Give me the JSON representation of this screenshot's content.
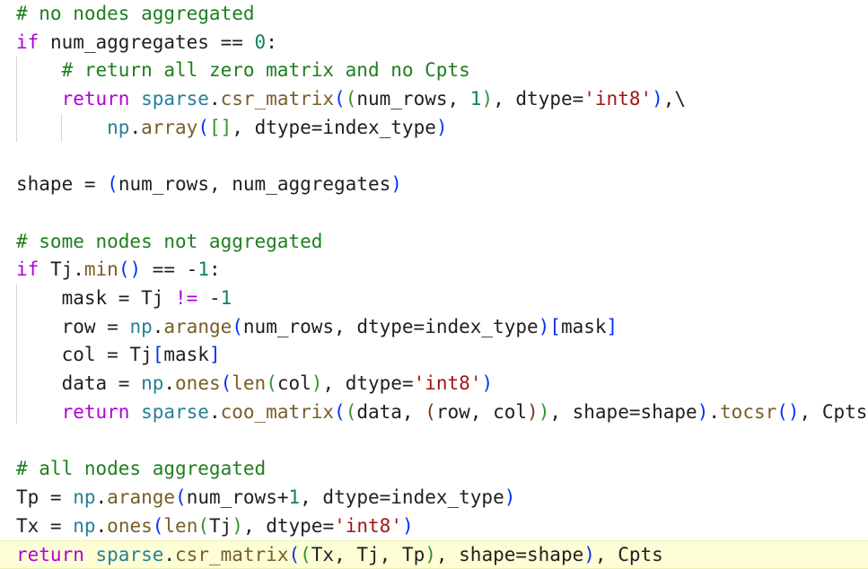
{
  "editor": {
    "lines": [
      {
        "tokens": [
          [
            "cm",
            "# no nodes aggregated"
          ]
        ]
      },
      {
        "tokens": [
          [
            "kw",
            "if"
          ],
          [
            "var",
            " num_aggregates "
          ],
          [
            "var",
            "=="
          ],
          [
            "var",
            " "
          ],
          [
            "num",
            "0"
          ],
          [
            "var",
            ":"
          ]
        ]
      },
      {
        "tokens": [
          [
            "var",
            "    "
          ],
          [
            "cm",
            "# return all zero matrix and no Cpts"
          ]
        ]
      },
      {
        "tokens": [
          [
            "var",
            "    "
          ],
          [
            "kw",
            "return"
          ],
          [
            "var",
            " "
          ],
          [
            "mod",
            "sparse"
          ],
          [
            "var",
            "."
          ],
          [
            "fn",
            "csr_matrix"
          ],
          [
            "bracket1",
            "("
          ],
          [
            "bracket2",
            "("
          ],
          [
            "var",
            "num_rows, "
          ],
          [
            "num",
            "1"
          ],
          [
            "bracket2",
            ")"
          ],
          [
            "var",
            ", dtype="
          ],
          [
            "str",
            "'int8'"
          ],
          [
            "bracket1",
            ")"
          ],
          [
            "var",
            ",\\"
          ]
        ]
      },
      {
        "tokens": [
          [
            "var",
            "        "
          ],
          [
            "mod",
            "np"
          ],
          [
            "var",
            "."
          ],
          [
            "fn",
            "array"
          ],
          [
            "bracket1",
            "("
          ],
          [
            "bracket2",
            "[]"
          ],
          [
            "var",
            ", dtype=index_type"
          ],
          [
            "bracket1",
            ")"
          ]
        ]
      },
      {
        "tokens": []
      },
      {
        "tokens": [
          [
            "var",
            "shape = "
          ],
          [
            "bracket1",
            "("
          ],
          [
            "var",
            "num_rows, num_aggregates"
          ],
          [
            "bracket1",
            ")"
          ]
        ]
      },
      {
        "tokens": []
      },
      {
        "tokens": [
          [
            "cm",
            "# some nodes not aggregated"
          ]
        ]
      },
      {
        "tokens": [
          [
            "kw",
            "if"
          ],
          [
            "var",
            " Tj."
          ],
          [
            "fn",
            "min"
          ],
          [
            "bracket1",
            "()"
          ],
          [
            "var",
            " == -"
          ],
          [
            "num",
            "1"
          ],
          [
            "var",
            ":"
          ]
        ]
      },
      {
        "tokens": [
          [
            "var",
            "    mask = Tj "
          ],
          [
            "kw",
            "!="
          ],
          [
            "var",
            " -"
          ],
          [
            "num",
            "1"
          ]
        ]
      },
      {
        "tokens": [
          [
            "var",
            "    row = "
          ],
          [
            "mod",
            "np"
          ],
          [
            "var",
            "."
          ],
          [
            "fn",
            "arange"
          ],
          [
            "bracket1",
            "("
          ],
          [
            "var",
            "num_rows, dtype=index_type"
          ],
          [
            "bracket1",
            ")"
          ],
          [
            "bracket1",
            "["
          ],
          [
            "var",
            "mask"
          ],
          [
            "bracket1",
            "]"
          ]
        ]
      },
      {
        "tokens": [
          [
            "var",
            "    col = Tj"
          ],
          [
            "bracket1",
            "["
          ],
          [
            "var",
            "mask"
          ],
          [
            "bracket1",
            "]"
          ]
        ]
      },
      {
        "tokens": [
          [
            "var",
            "    data = "
          ],
          [
            "mod",
            "np"
          ],
          [
            "var",
            "."
          ],
          [
            "fn",
            "ones"
          ],
          [
            "bracket1",
            "("
          ],
          [
            "fn",
            "len"
          ],
          [
            "bracket2",
            "("
          ],
          [
            "var",
            "col"
          ],
          [
            "bracket2",
            ")"
          ],
          [
            "var",
            ", dtype="
          ],
          [
            "str",
            "'int8'"
          ],
          [
            "bracket1",
            ")"
          ]
        ]
      },
      {
        "tokens": [
          [
            "var",
            "    "
          ],
          [
            "kw",
            "return"
          ],
          [
            "var",
            " "
          ],
          [
            "mod",
            "sparse"
          ],
          [
            "var",
            "."
          ],
          [
            "fn",
            "coo_matrix"
          ],
          [
            "bracket1",
            "("
          ],
          [
            "bracket2",
            "("
          ],
          [
            "var",
            "data, "
          ],
          [
            "bracket3",
            "("
          ],
          [
            "var",
            "row, col"
          ],
          [
            "bracket3",
            ")"
          ],
          [
            "bracket2",
            ")"
          ],
          [
            "var",
            ", shape=shape"
          ],
          [
            "bracket1",
            ")"
          ],
          [
            "var",
            "."
          ],
          [
            "fn",
            "tocsr"
          ],
          [
            "bracket1",
            "()"
          ],
          [
            "var",
            ", Cpts"
          ]
        ]
      },
      {
        "tokens": []
      },
      {
        "tokens": [
          [
            "cm",
            "# all nodes aggregated"
          ]
        ]
      },
      {
        "tokens": [
          [
            "var",
            "Tp = "
          ],
          [
            "mod",
            "np"
          ],
          [
            "var",
            "."
          ],
          [
            "fn",
            "arange"
          ],
          [
            "bracket1",
            "("
          ],
          [
            "var",
            "num_rows+"
          ],
          [
            "num",
            "1"
          ],
          [
            "var",
            ", dtype=index_type"
          ],
          [
            "bracket1",
            ")"
          ]
        ]
      },
      {
        "tokens": [
          [
            "var",
            "Tx = "
          ],
          [
            "mod",
            "np"
          ],
          [
            "var",
            "."
          ],
          [
            "fn",
            "ones"
          ],
          [
            "bracket1",
            "("
          ],
          [
            "fn",
            "len"
          ],
          [
            "bracket2",
            "("
          ],
          [
            "var",
            "Tj"
          ],
          [
            "bracket2",
            ")"
          ],
          [
            "var",
            ", dtype="
          ],
          [
            "str",
            "'int8'"
          ],
          [
            "bracket1",
            ")"
          ]
        ]
      },
      {
        "tokens": [
          [
            "kw",
            "return"
          ],
          [
            "var",
            " "
          ],
          [
            "mod",
            "sparse"
          ],
          [
            "var",
            "."
          ],
          [
            "fn",
            "csr_matrix"
          ],
          [
            "bracket1",
            "("
          ],
          [
            "bracket2",
            "("
          ],
          [
            "var",
            "Tx, Tj, Tp"
          ],
          [
            "bracket2",
            ")"
          ],
          [
            "var",
            ", shape=shape"
          ],
          [
            "bracket1",
            ")"
          ],
          [
            "var",
            ", Cpts"
          ]
        ]
      }
    ],
    "highlighted_line": 19
  }
}
